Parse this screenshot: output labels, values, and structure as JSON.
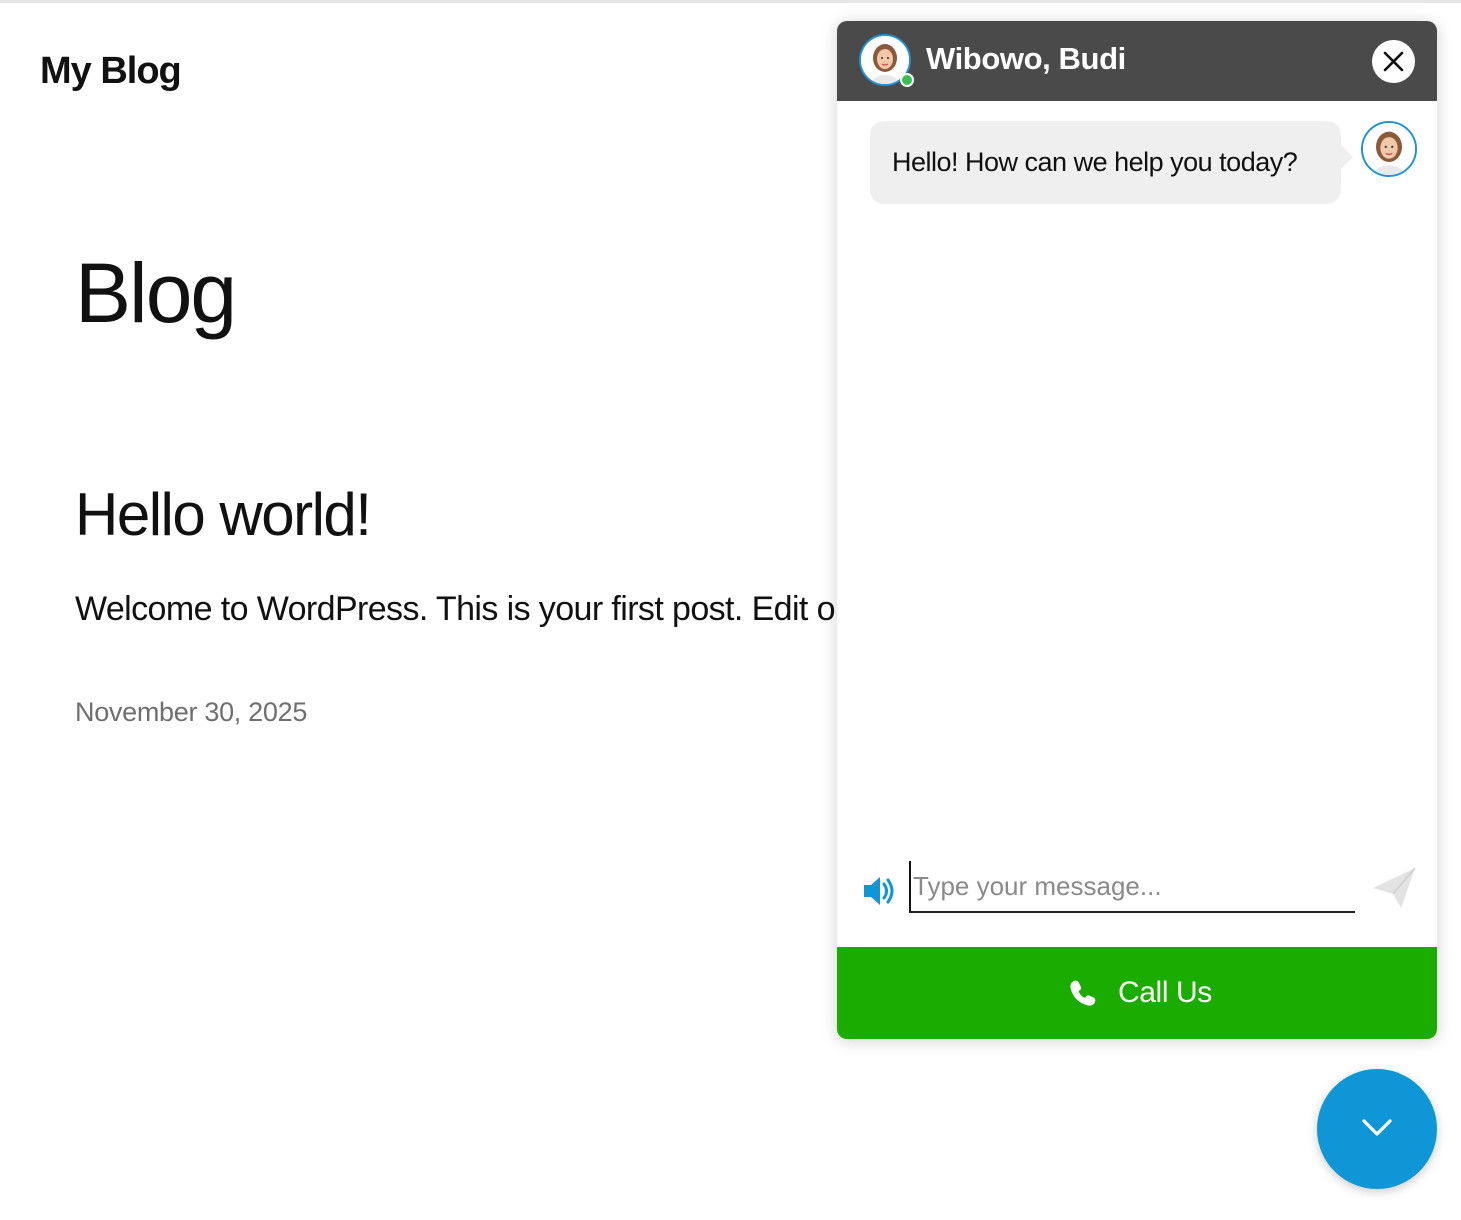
{
  "site": {
    "title": "My Blog"
  },
  "page": {
    "heading": "Blog"
  },
  "post": {
    "title": "Hello world!",
    "excerpt": "Welcome to WordPress. This is your first post. Edit or delete it, then start writing!",
    "date": "November 30, 2025"
  },
  "chat": {
    "agent_name": "Wibowo, Budi",
    "status": "online",
    "messages": [
      {
        "text": "Hello! How can we help you today?"
      }
    ],
    "input": {
      "value": "",
      "placeholder": "Type your message..."
    },
    "call_button_label": "Call Us",
    "icons": {
      "close": "close-icon",
      "speaker": "speaker-icon",
      "send": "send-icon",
      "phone": "phone-icon",
      "launcher": "chevron-down-icon"
    },
    "colors": {
      "header": "#4a4a4a",
      "accent": "#0e96d6",
      "call": "#1aad00",
      "online": "#3bc14a",
      "bubble": "#efefef"
    }
  }
}
